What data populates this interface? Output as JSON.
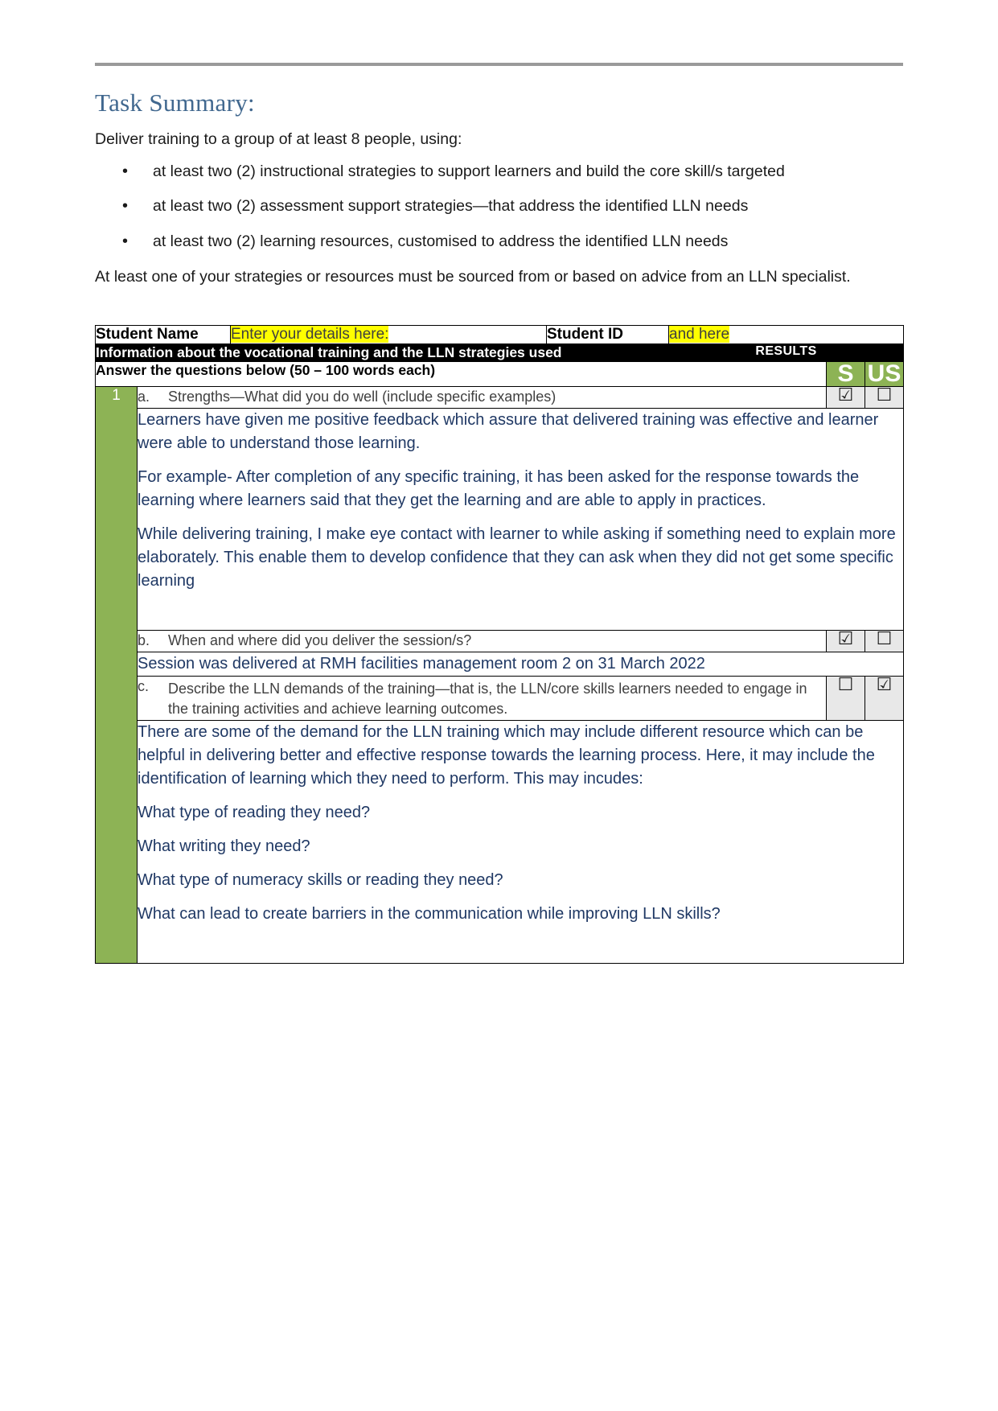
{
  "document": {
    "title": "Task Summary:",
    "intro": "Deliver training to a group of at least 8 people, using:",
    "bullets": [
      "at least two (2) instructional strategies to support learners and build the core skill/s targeted",
      "at least two (2) assessment support strategies—that address the identified LLN needs",
      "at least two (2) learning resources, customised to address the identified LLN needs"
    ],
    "closing": "At least one of your strategies or resources must be sourced from or based on advice from an LLN specialist."
  },
  "student_row": {
    "name_label": "Student Name",
    "name_value": "Enter your details here:",
    "id_label": "Student ID",
    "id_value": "and here"
  },
  "table_header": {
    "black_bar_left": "Information about the vocational training and the LLN strategies used",
    "black_bar_right": "RESULTS",
    "instructions": "Answer the questions below (50 – 100 words each)",
    "col_s": "S",
    "col_us": "US"
  },
  "question_number": "1",
  "questions": [
    {
      "letter": "a.",
      "text": "Strengths—What did you do well (include specific examples)",
      "s_checked": true,
      "us_checked": false,
      "answer": [
        "Learners have given me positive feedback which assure that delivered training was effective and learner were able to understand those learning.",
        "For example- After completion of any specific training, it has been asked for the response towards the learning where learners said that they get the learning and are able to apply in practices.",
        "While delivering training, I make eye contact with learner to while asking if something need to explain more elaborately. This enable them to develop confidence that they can ask when they did not get some specific learning"
      ]
    },
    {
      "letter": "b.",
      "text": "When and where did you deliver the session/s?",
      "s_checked": true,
      "us_checked": false,
      "answer": [
        "Session was delivered at RMH facilities management room 2 on 31 March 2022"
      ]
    },
    {
      "letter": "c.",
      "text": "Describe the LLN demands of the training—that is, the LLN/core skills learners needed to engage in the training activities and achieve learning outcomes.",
      "s_checked": false,
      "us_checked": true,
      "answer": [
        "There are some of the demand for the LLN training which may include different resource which can be helpful in delivering better and effective response towards the learning process. Here, it may include the identification of learning which they need to perform. This may incudes:",
        " What type of reading they need?",
        "What writing they need?",
        "What type of numeracy skills or reading they need?",
        "What can lead to create barriers in the communication while improving LLN skills?"
      ]
    }
  ],
  "glyphs": {
    "checked": "☑",
    "unchecked": "☐"
  },
  "colors": {
    "title_blue": "#41688f",
    "answer_blue": "#1f3864",
    "accent_green": "#8db355",
    "highlight_yellow": "#ffff00",
    "checkbox_bg": "#e8e8e8",
    "rule_gray": "#9a9a9a"
  }
}
